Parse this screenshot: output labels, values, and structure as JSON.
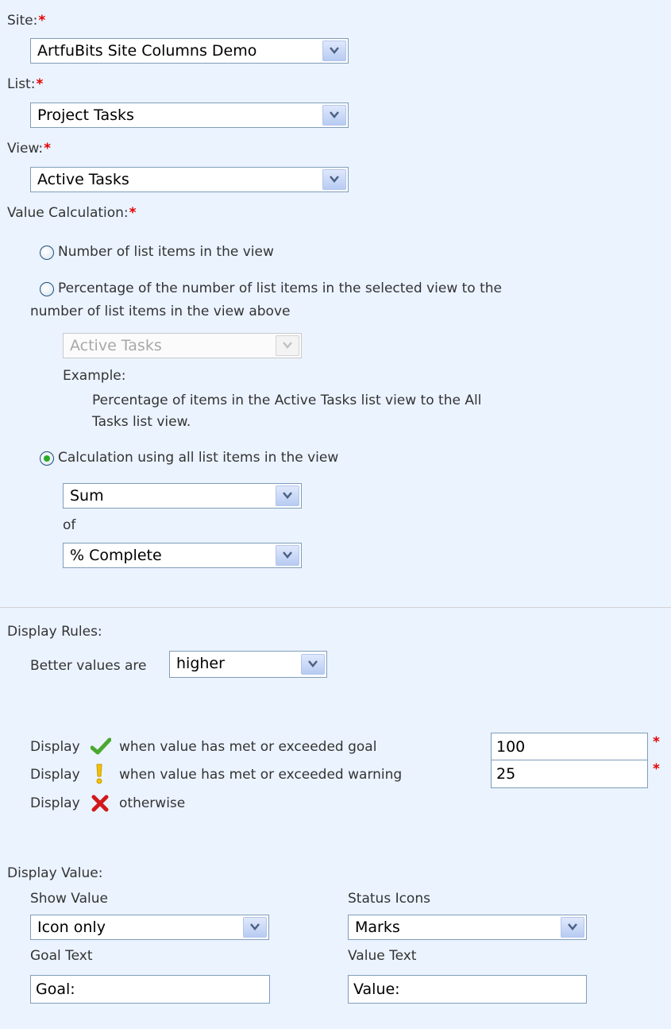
{
  "site": {
    "label": "Site:",
    "required_mark": "*",
    "value": "ArtfuBits Site Columns Demo"
  },
  "list": {
    "label": "List:",
    "required_mark": "*",
    "value": "Project Tasks"
  },
  "view": {
    "label": "View:",
    "required_mark": "*",
    "value": "Active Tasks"
  },
  "value_calculation": {
    "label": "Value Calculation:",
    "required_mark": "*",
    "option1": {
      "label": "Number of list items in the view",
      "checked": false
    },
    "option2": {
      "label_line1": "Percentage of the number of list items in the selected view to the",
      "label_line2": "number of list items in the view above",
      "checked": false,
      "compare_view": "Active Tasks",
      "example_label": "Example:",
      "example_line1": "Percentage of items in the Active Tasks list view to the All",
      "example_line2": "Tasks list view."
    },
    "option3": {
      "label": "Calculation using all list items in the view",
      "checked": true,
      "function": "Sum",
      "of_label": "of",
      "column": "% Complete"
    }
  },
  "display_rules": {
    "label": "Display Rules:",
    "better_label": "Better values are",
    "better_value": "higher",
    "goal": {
      "prefix": "Display",
      "text": "when value has met or exceeded goal",
      "value": "100",
      "required_mark": "*",
      "icon": "green-check-icon"
    },
    "warning": {
      "prefix": "Display",
      "text": "when value has met or exceeded warning",
      "value": "25",
      "required_mark": "*",
      "icon": "yellow-exclamation-icon"
    },
    "otherwise": {
      "prefix": "Display",
      "text": "otherwise",
      "icon": "red-x-icon"
    }
  },
  "display_value": {
    "label": "Display Value:",
    "show_value_label": "Show Value",
    "show_value": "Icon only",
    "status_icons_label": "Status Icons",
    "status_icons": "Marks",
    "goal_text_label": "Goal Text",
    "goal_text": "Goal:",
    "value_text_label": "Value Text",
    "value_text": "Value:"
  },
  "colors": {
    "background": "#ebf3ff",
    "required": "#e30000",
    "input_border": "#7f9db9",
    "selected_radio": "#2aab2a"
  }
}
